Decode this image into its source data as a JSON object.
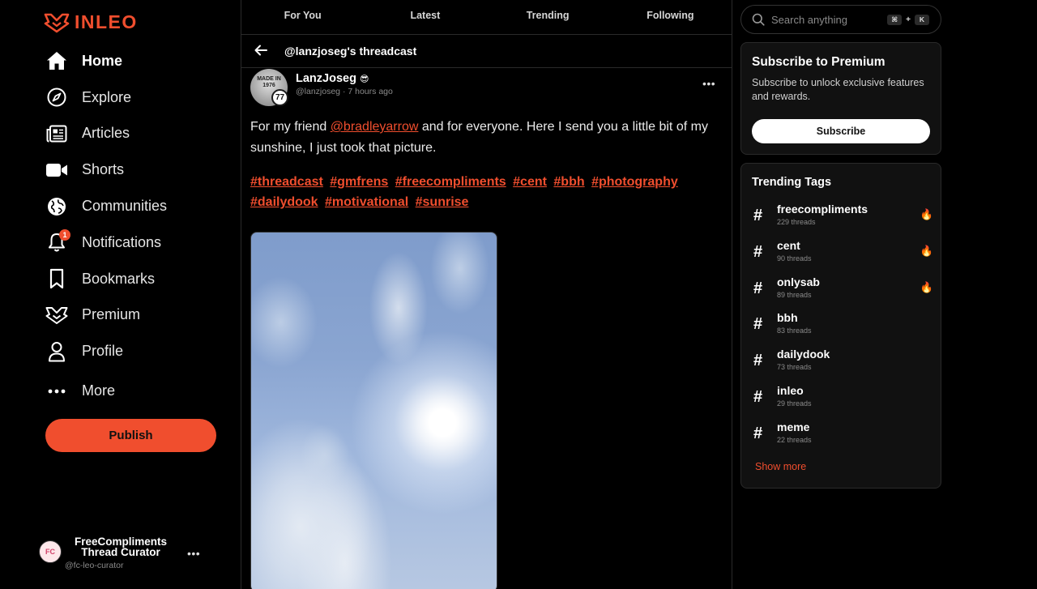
{
  "brand": {
    "logo_text": "INLEO",
    "accent": "#f04e2e"
  },
  "nav": {
    "items": [
      {
        "label": "Home",
        "icon": "home-icon"
      },
      {
        "label": "Explore",
        "icon": "compass-icon"
      },
      {
        "label": "Articles",
        "icon": "newspaper-icon"
      },
      {
        "label": "Shorts",
        "icon": "video-icon"
      },
      {
        "label": "Communities",
        "icon": "globe-icon"
      },
      {
        "label": "Notifications",
        "icon": "bell-icon",
        "badge": "1"
      },
      {
        "label": "Bookmarks",
        "icon": "bookmark-icon"
      },
      {
        "label": "Premium",
        "icon": "premium-icon"
      },
      {
        "label": "Profile",
        "icon": "user-icon"
      },
      {
        "label": "More",
        "icon": "ellipsis-icon"
      }
    ],
    "publish_label": "Publish"
  },
  "account": {
    "name": "FreeCompliments Thread Curator",
    "handle": "@fc-leo-curator",
    "avatar_text": "FC"
  },
  "feed_tabs": [
    "For You",
    "Latest",
    "Trending",
    "Following"
  ],
  "thread": {
    "title": "@lanzjoseg's threadcast",
    "author": {
      "name": "LanzJoseg",
      "handle": "@lanzjoseg",
      "time": "7 hours ago",
      "level": "77",
      "avatar_caption": "MADE IN 1976"
    },
    "text_before": "For my friend ",
    "mention": "@bradleyarrow",
    "text_after": " and for everyone. Here I send you a little bit of my sunshine, I just took that picture.",
    "tags": [
      "#threadcast",
      "#gmfrens",
      "#freecompliments",
      "#cent",
      "#bbh",
      "#photography",
      "#dailydook",
      "#motivational",
      "#sunrise"
    ]
  },
  "search": {
    "placeholder": "Search anything",
    "key1": "⌘",
    "plus": "+",
    "key2": "K"
  },
  "premium": {
    "title": "Subscribe to Premium",
    "description": "Subscribe to unlock exclusive features and rewards.",
    "button": "Subscribe"
  },
  "trending": {
    "title": "Trending Tags",
    "items": [
      {
        "tag": "freecompliments",
        "count": "229 threads",
        "hot": true
      },
      {
        "tag": "cent",
        "count": "90 threads",
        "hot": true
      },
      {
        "tag": "onlysab",
        "count": "89 threads",
        "hot": true
      },
      {
        "tag": "bbh",
        "count": "83 threads",
        "hot": false
      },
      {
        "tag": "dailydook",
        "count": "73 threads",
        "hot": false
      },
      {
        "tag": "inleo",
        "count": "29 threads",
        "hot": false
      },
      {
        "tag": "meme",
        "count": "22 threads",
        "hot": false
      }
    ],
    "show_more": "Show more"
  }
}
